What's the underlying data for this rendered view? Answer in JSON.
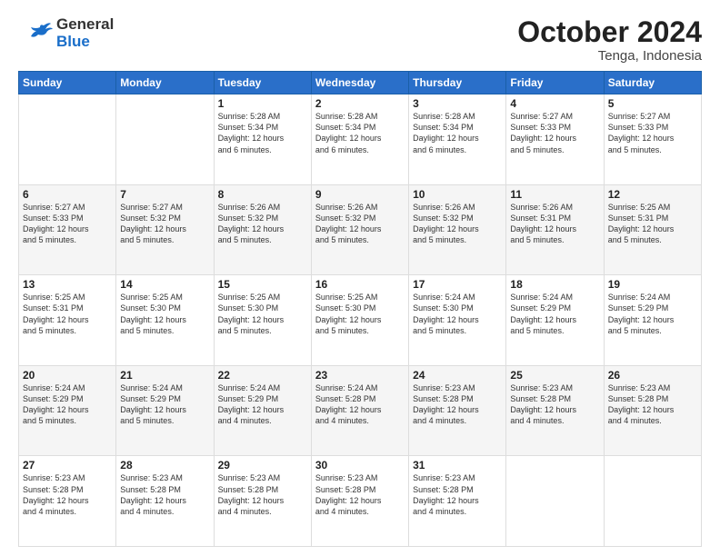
{
  "header": {
    "logo_general": "General",
    "logo_blue": "Blue",
    "month": "October 2024",
    "location": "Tenga, Indonesia"
  },
  "days_of_week": [
    "Sunday",
    "Monday",
    "Tuesday",
    "Wednesday",
    "Thursday",
    "Friday",
    "Saturday"
  ],
  "weeks": [
    [
      {
        "day": "",
        "info": ""
      },
      {
        "day": "",
        "info": ""
      },
      {
        "day": "1",
        "info": "Sunrise: 5:28 AM\nSunset: 5:34 PM\nDaylight: 12 hours\nand 6 minutes."
      },
      {
        "day": "2",
        "info": "Sunrise: 5:28 AM\nSunset: 5:34 PM\nDaylight: 12 hours\nand 6 minutes."
      },
      {
        "day": "3",
        "info": "Sunrise: 5:28 AM\nSunset: 5:34 PM\nDaylight: 12 hours\nand 6 minutes."
      },
      {
        "day": "4",
        "info": "Sunrise: 5:27 AM\nSunset: 5:33 PM\nDaylight: 12 hours\nand 5 minutes."
      },
      {
        "day": "5",
        "info": "Sunrise: 5:27 AM\nSunset: 5:33 PM\nDaylight: 12 hours\nand 5 minutes."
      }
    ],
    [
      {
        "day": "6",
        "info": "Sunrise: 5:27 AM\nSunset: 5:33 PM\nDaylight: 12 hours\nand 5 minutes."
      },
      {
        "day": "7",
        "info": "Sunrise: 5:27 AM\nSunset: 5:32 PM\nDaylight: 12 hours\nand 5 minutes."
      },
      {
        "day": "8",
        "info": "Sunrise: 5:26 AM\nSunset: 5:32 PM\nDaylight: 12 hours\nand 5 minutes."
      },
      {
        "day": "9",
        "info": "Sunrise: 5:26 AM\nSunset: 5:32 PM\nDaylight: 12 hours\nand 5 minutes."
      },
      {
        "day": "10",
        "info": "Sunrise: 5:26 AM\nSunset: 5:32 PM\nDaylight: 12 hours\nand 5 minutes."
      },
      {
        "day": "11",
        "info": "Sunrise: 5:26 AM\nSunset: 5:31 PM\nDaylight: 12 hours\nand 5 minutes."
      },
      {
        "day": "12",
        "info": "Sunrise: 5:25 AM\nSunset: 5:31 PM\nDaylight: 12 hours\nand 5 minutes."
      }
    ],
    [
      {
        "day": "13",
        "info": "Sunrise: 5:25 AM\nSunset: 5:31 PM\nDaylight: 12 hours\nand 5 minutes."
      },
      {
        "day": "14",
        "info": "Sunrise: 5:25 AM\nSunset: 5:30 PM\nDaylight: 12 hours\nand 5 minutes."
      },
      {
        "day": "15",
        "info": "Sunrise: 5:25 AM\nSunset: 5:30 PM\nDaylight: 12 hours\nand 5 minutes."
      },
      {
        "day": "16",
        "info": "Sunrise: 5:25 AM\nSunset: 5:30 PM\nDaylight: 12 hours\nand 5 minutes."
      },
      {
        "day": "17",
        "info": "Sunrise: 5:24 AM\nSunset: 5:30 PM\nDaylight: 12 hours\nand 5 minutes."
      },
      {
        "day": "18",
        "info": "Sunrise: 5:24 AM\nSunset: 5:29 PM\nDaylight: 12 hours\nand 5 minutes."
      },
      {
        "day": "19",
        "info": "Sunrise: 5:24 AM\nSunset: 5:29 PM\nDaylight: 12 hours\nand 5 minutes."
      }
    ],
    [
      {
        "day": "20",
        "info": "Sunrise: 5:24 AM\nSunset: 5:29 PM\nDaylight: 12 hours\nand 5 minutes."
      },
      {
        "day": "21",
        "info": "Sunrise: 5:24 AM\nSunset: 5:29 PM\nDaylight: 12 hours\nand 5 minutes."
      },
      {
        "day": "22",
        "info": "Sunrise: 5:24 AM\nSunset: 5:29 PM\nDaylight: 12 hours\nand 4 minutes."
      },
      {
        "day": "23",
        "info": "Sunrise: 5:24 AM\nSunset: 5:28 PM\nDaylight: 12 hours\nand 4 minutes."
      },
      {
        "day": "24",
        "info": "Sunrise: 5:23 AM\nSunset: 5:28 PM\nDaylight: 12 hours\nand 4 minutes."
      },
      {
        "day": "25",
        "info": "Sunrise: 5:23 AM\nSunset: 5:28 PM\nDaylight: 12 hours\nand 4 minutes."
      },
      {
        "day": "26",
        "info": "Sunrise: 5:23 AM\nSunset: 5:28 PM\nDaylight: 12 hours\nand 4 minutes."
      }
    ],
    [
      {
        "day": "27",
        "info": "Sunrise: 5:23 AM\nSunset: 5:28 PM\nDaylight: 12 hours\nand 4 minutes."
      },
      {
        "day": "28",
        "info": "Sunrise: 5:23 AM\nSunset: 5:28 PM\nDaylight: 12 hours\nand 4 minutes."
      },
      {
        "day": "29",
        "info": "Sunrise: 5:23 AM\nSunset: 5:28 PM\nDaylight: 12 hours\nand 4 minutes."
      },
      {
        "day": "30",
        "info": "Sunrise: 5:23 AM\nSunset: 5:28 PM\nDaylight: 12 hours\nand 4 minutes."
      },
      {
        "day": "31",
        "info": "Sunrise: 5:23 AM\nSunset: 5:28 PM\nDaylight: 12 hours\nand 4 minutes."
      },
      {
        "day": "",
        "info": ""
      },
      {
        "day": "",
        "info": ""
      }
    ]
  ]
}
